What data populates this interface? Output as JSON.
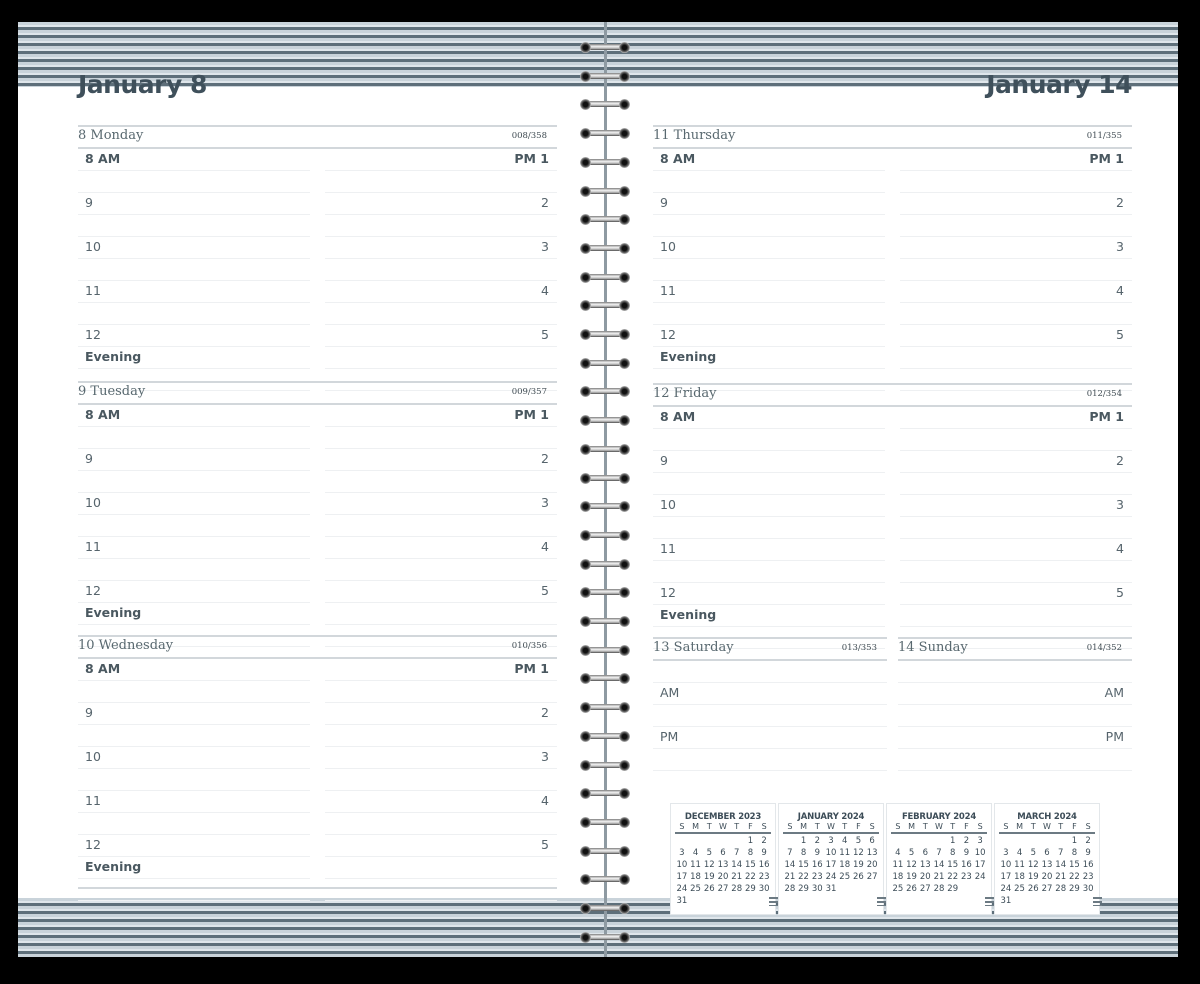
{
  "planner": {
    "left_page": {
      "title": "January 8",
      "days": [
        {
          "name": "8 Monday",
          "day_of_year": "008/358"
        },
        {
          "name": "9 Tuesday",
          "day_of_year": "009/357"
        },
        {
          "name": "10 Wednesday",
          "day_of_year": "010/356"
        }
      ]
    },
    "right_page": {
      "title": "January 14",
      "days": [
        {
          "name": "11 Thursday",
          "day_of_year": "011/355"
        },
        {
          "name": "12 Friday",
          "day_of_year": "012/354"
        }
      ],
      "weekend": [
        {
          "name": "13 Saturday",
          "day_of_year": "013/353",
          "am": "AM",
          "pm": "PM"
        },
        {
          "name": "14 Sunday",
          "day_of_year": "014/352",
          "am": "AM",
          "pm": "PM"
        }
      ]
    },
    "time_slots": {
      "am": [
        "8 AM",
        "",
        "9",
        "",
        "10",
        "",
        "11",
        "",
        "12",
        "Evening",
        ""
      ],
      "pm": [
        "PM 1",
        "",
        "2",
        "",
        "3",
        "",
        "4",
        "",
        "5",
        "",
        ""
      ]
    },
    "mini_calendars": [
      {
        "title": "DECEMBER 2023",
        "weekdays": [
          "S",
          "M",
          "T",
          "W",
          "T",
          "F",
          "S"
        ],
        "cells": [
          "",
          "",
          "",
          "",
          "",
          "1",
          "2",
          "3",
          "4",
          "5",
          "6",
          "7",
          "8",
          "9",
          "10",
          "11",
          "12",
          "13",
          "14",
          "15",
          "16",
          "17",
          "18",
          "19",
          "20",
          "21",
          "22",
          "23",
          "24",
          "25",
          "26",
          "27",
          "28",
          "29",
          "30",
          "31"
        ]
      },
      {
        "title": "JANUARY 2024",
        "weekdays": [
          "S",
          "M",
          "T",
          "W",
          "T",
          "F",
          "S"
        ],
        "cells": [
          "",
          "1",
          "2",
          "3",
          "4",
          "5",
          "6",
          "7",
          "8",
          "9",
          "10",
          "11",
          "12",
          "13",
          "14",
          "15",
          "16",
          "17",
          "18",
          "19",
          "20",
          "21",
          "22",
          "23",
          "24",
          "25",
          "26",
          "27",
          "28",
          "29",
          "30",
          "31"
        ]
      },
      {
        "title": "FEBRUARY 2024",
        "weekdays": [
          "S",
          "M",
          "T",
          "W",
          "T",
          "F",
          "S"
        ],
        "cells": [
          "",
          "",
          "",
          "",
          "1",
          "2",
          "3",
          "4",
          "5",
          "6",
          "7",
          "8",
          "9",
          "10",
          "11",
          "12",
          "13",
          "14",
          "15",
          "16",
          "17",
          "18",
          "19",
          "20",
          "21",
          "22",
          "23",
          "24",
          "25",
          "26",
          "27",
          "28",
          "29"
        ]
      },
      {
        "title": "MARCH 2024",
        "weekdays": [
          "S",
          "M",
          "T",
          "W",
          "T",
          "F",
          "S"
        ],
        "cells": [
          "",
          "",
          "",
          "",
          "",
          "1",
          "2",
          "3",
          "4",
          "5",
          "6",
          "7",
          "8",
          "9",
          "10",
          "11",
          "12",
          "13",
          "14",
          "15",
          "16",
          "17",
          "18",
          "19",
          "20",
          "21",
          "22",
          "23",
          "24",
          "25",
          "26",
          "27",
          "28",
          "29",
          "30",
          "31"
        ]
      }
    ],
    "colors": {
      "text": "#4a5b66",
      "rule": "#d2d7db",
      "stripe_dark": "#5e6f7a",
      "stripe_light": "#c9d3da"
    }
  }
}
